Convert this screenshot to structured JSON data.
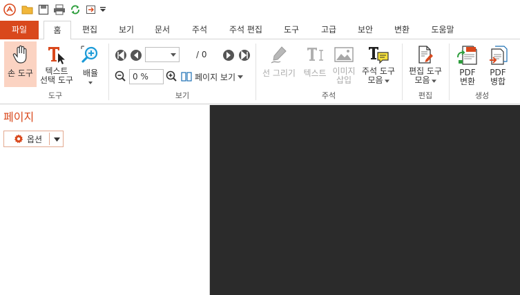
{
  "colors": {
    "accent": "#d9481c",
    "doc_bg": "#2b2b2b",
    "hand_bg": "#fbd3c2"
  },
  "menu": {
    "tabs": [
      "파일",
      "홈",
      "편집",
      "보기",
      "문서",
      "주석",
      "주석 편집",
      "도구",
      "고급",
      "보안",
      "변환",
      "도움말"
    ]
  },
  "ribbon": {
    "hand_tool": "손 도구",
    "text_select_line1": "텍스트",
    "text_select_line2": "선택 도구",
    "zoom": "배율",
    "page_separator": "/ 0",
    "zoom_value": "0 %",
    "page_view": "페이지 보기",
    "draw_line": "선 그리기",
    "text": "텍스트",
    "image_line1": "이미지",
    "image_line2": "삽입",
    "annot_line1": "주석 도구",
    "annot_line2": "모음",
    "edit_line1": "편집 도구",
    "edit_line2": "모음",
    "pdf_convert_line1": "PDF",
    "pdf_convert_line2": "변환",
    "pdf_merge_line1": "PDF",
    "pdf_merge_line2": "병합",
    "groups": {
      "tools": "도구",
      "view": "보기",
      "annotation": "주석",
      "edit": "편집",
      "create": "생성"
    }
  },
  "panel": {
    "title": "페이지",
    "options": "옵션"
  }
}
